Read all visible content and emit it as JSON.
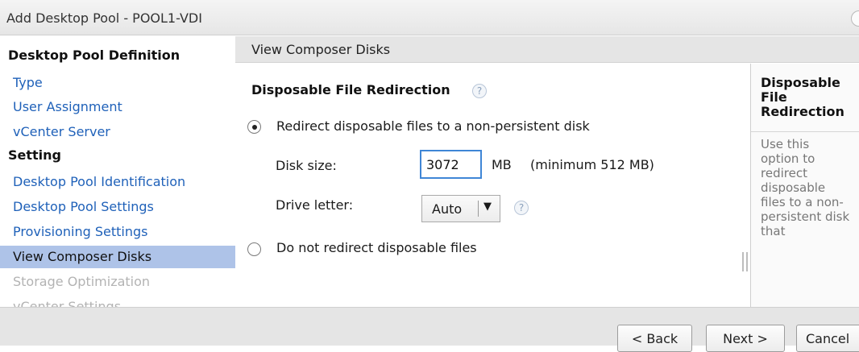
{
  "window": {
    "title": "Add Desktop Pool - POOL1-VDI"
  },
  "sidebar": {
    "sections": [
      {
        "label": "Desktop Pool Definition"
      },
      {
        "label": "Setting"
      }
    ],
    "items": [
      {
        "label": "Type"
      },
      {
        "label": "User Assignment"
      },
      {
        "label": "vCenter Server"
      },
      {
        "label": "Desktop Pool Identification"
      },
      {
        "label": "Desktop Pool Settings"
      },
      {
        "label": "Provisioning Settings"
      },
      {
        "label": "View Composer Disks",
        "selected": true
      },
      {
        "label": "Storage Optimization",
        "disabled": true
      },
      {
        "label": "vCenter Settings",
        "disabled": true
      }
    ]
  },
  "panel": {
    "header": "View Composer Disks",
    "section_title": "Disposable File Redirection",
    "option_redirect": "Redirect disposable files to a non-persistent disk",
    "disk_size_label": "Disk size:",
    "disk_size_value": "3072",
    "disk_size_unit": "MB",
    "disk_size_hint": "(minimum 512 MB)",
    "drive_letter_label": "Drive letter:",
    "drive_letter_value": "Auto",
    "option_no_redirect": "Do not redirect disposable files",
    "selected_option": "redirect"
  },
  "help": {
    "title": "Disposable File Redirection",
    "body": "Use this option to redirect disposable files to a non-persistent disk that"
  },
  "footer": {
    "back_label": "< Back",
    "next_label": "Next >",
    "cancel_label": "Cancel"
  },
  "colors": {
    "link": "#1f61b9",
    "selected_bg": "#aec3e8",
    "disabled": "#b3b3b3",
    "accent_border": "#3f86d6"
  }
}
